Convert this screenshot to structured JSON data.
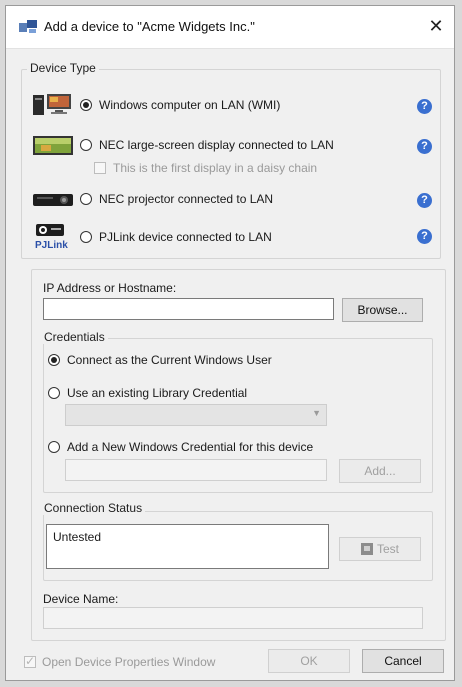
{
  "window": {
    "title": "Add a device to \"Acme Widgets Inc.\"",
    "close_glyph": "✕"
  },
  "device_type": {
    "label": "Device Type",
    "options": [
      {
        "label": "Windows computer on LAN (WMI)",
        "selected": true
      },
      {
        "label": "NEC large-screen display connected to LAN",
        "selected": false
      },
      {
        "label": "NEC projector connected to LAN",
        "selected": false
      },
      {
        "label": "PJLink device connected to LAN",
        "selected": false
      }
    ],
    "daisy_chain_label": "This is the first display in a daisy chain",
    "help_glyph": "?",
    "pjlink_icon_text": "PJLink"
  },
  "ip": {
    "label": "IP Address or Hostname:",
    "value": "",
    "browse_label": "Browse..."
  },
  "credentials": {
    "label": "Credentials",
    "current_user_label": "Connect as the Current Windows User",
    "library_label": "Use an existing Library Credential",
    "library_selected": "",
    "new_label": "Add a New Windows Credential for this device",
    "new_value": "",
    "add_label": "Add..."
  },
  "connection": {
    "label": "Connection Status",
    "status": "Untested",
    "test_label": "Test"
  },
  "device_name": {
    "label": "Device Name:",
    "value": ""
  },
  "footer": {
    "open_props_label": "Open Device Properties Window",
    "ok_label": "OK",
    "cancel_label": "Cancel"
  },
  "colors": {
    "help_blue": "#3a6fd0",
    "window_bg": "#f0f0f0",
    "titlebar_bg": "#ffffff"
  },
  "icons": [
    "app-icon",
    "close-icon",
    "windows-computer-icon",
    "large-screen-display-icon",
    "projector-icon",
    "pjlink-icon",
    "help-icon",
    "shield-icon",
    "dropdown-arrow-icon"
  ]
}
